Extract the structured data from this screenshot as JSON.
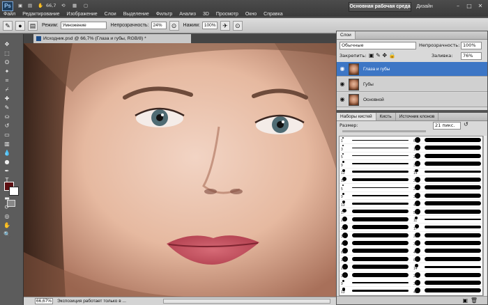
{
  "app": {
    "logo": "Ps",
    "zoom": "66,7",
    "workspace": "Основная рабочая среда",
    "design": "Дизайн",
    "menu": [
      "Файл",
      "Редактирование",
      "Изображение",
      "Слои",
      "Выделение",
      "Фильтр",
      "Анализ",
      "3D",
      "Просмотр",
      "Окно",
      "Справка"
    ]
  },
  "options": {
    "mode_label": "Режим:",
    "mode_value": "Умножение",
    "opacity_label": "Непрозрачность:",
    "opacity_value": "24%",
    "pressure_label": "Нажим:",
    "pressure_value": "100%"
  },
  "document": {
    "tab_title": "Исходник.psd @ 66,7% (Глаза и губы, RGB/8) *",
    "status_zoom": "66,67%",
    "status_text": "Экспозиция работает только в ..."
  },
  "layers_panel": {
    "tab": "Слои",
    "blend_mode": "Обычные",
    "opacity_label": "Непрозрачность:",
    "opacity_value": "100%",
    "lock_label": "Закрепить:",
    "fill_label": "Заливка:",
    "fill_value": "76%",
    "layers": [
      {
        "name": "Глаза и губы",
        "selected": true
      },
      {
        "name": "Губы",
        "selected": false
      },
      {
        "name": "Основной",
        "selected": false
      }
    ]
  },
  "brushes_panel": {
    "tabs": [
      "Наборы кистей",
      "Кисть",
      "Источник клонов"
    ],
    "size_label": "Размер:",
    "size_value": "21 пикс.",
    "left_column": [
      "1",
      "3",
      "5",
      "9",
      "13",
      "19",
      "5",
      "9",
      "13",
      "17",
      "21",
      "27",
      "35",
      "45",
      "65",
      "100",
      "200",
      "300",
      "9",
      "13",
      "19"
    ],
    "right_column": [
      "65",
      "100",
      "200",
      "300",
      "14",
      "24",
      "27",
      "39",
      "46",
      "59",
      "11",
      "17",
      "23",
      "36",
      "44",
      "60",
      "14",
      "26",
      "33",
      "42",
      "55"
    ]
  },
  "colors": {
    "foreground": "#5c0f12",
    "background": "#ffffff",
    "selection": "#3d76c5"
  }
}
